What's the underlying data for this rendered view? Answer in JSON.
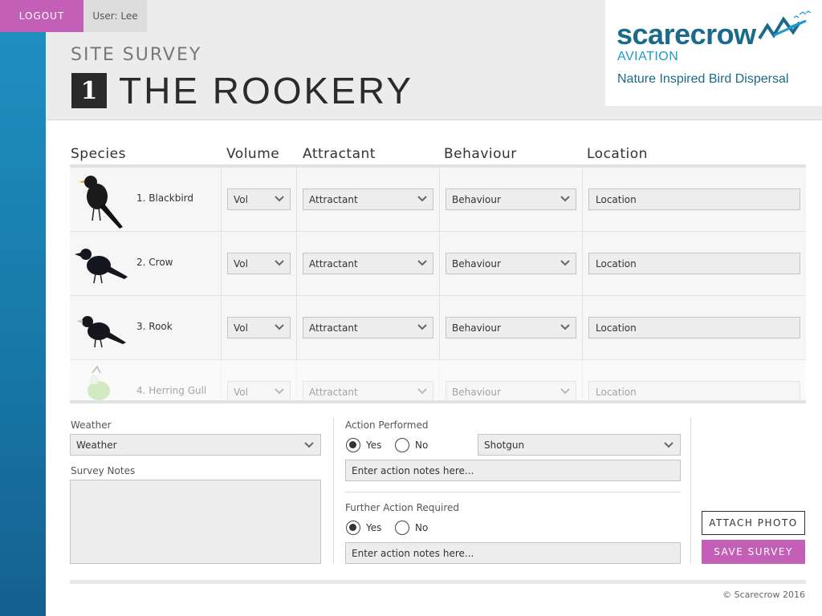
{
  "topbar": {
    "logout_label": "LOGOUT",
    "user_label": "User: Lee"
  },
  "header": {
    "section_title": "SITE SURVEY",
    "site_number": "1",
    "site_name": "THE ROOKERY"
  },
  "logo": {
    "name": "scarecrow",
    "sub": "AVIATION",
    "tagline": "Nature Inspired Bird Dispersal"
  },
  "table": {
    "headers": [
      "Species",
      "Volume",
      "Attractant",
      "Behaviour",
      "Location"
    ],
    "rows": [
      {
        "name": "1. Blackbird",
        "volume": "Vol",
        "attractant": "Attractant",
        "behaviour": "Behaviour",
        "location": "Location"
      },
      {
        "name": "2. Crow",
        "volume": "Vol",
        "attractant": "Attractant",
        "behaviour": "Behaviour",
        "location": "Location"
      },
      {
        "name": "3. Rook",
        "volume": "Vol",
        "attractant": "Attractant",
        "behaviour": "Behaviour",
        "location": "Location"
      },
      {
        "name": "4. Herring Gull",
        "volume": "Vol",
        "attractant": "Attractant",
        "behaviour": "Behaviour",
        "location": "Location"
      }
    ]
  },
  "form": {
    "weather_label": "Weather",
    "weather_value": "Weather",
    "notes_label": "Survey Notes",
    "action_label": "Action Performed",
    "action_yes": "Yes",
    "action_no": "No",
    "action_method": "Shotgun",
    "action_notes_placeholder": "Enter action notes here...",
    "further_label": "Further Action Required",
    "further_yes": "Yes",
    "further_no": "No",
    "further_notes_placeholder": "Enter action notes here..."
  },
  "buttons": {
    "attach": "ATTACH PHOTO",
    "save": "SAVE SURVEY"
  },
  "footer": {
    "copyright": "© Scarecrow 2016"
  },
  "colors": {
    "accent": "#c45fb8",
    "sidebar": "#1778a8",
    "brand": "#1a6a8c"
  }
}
